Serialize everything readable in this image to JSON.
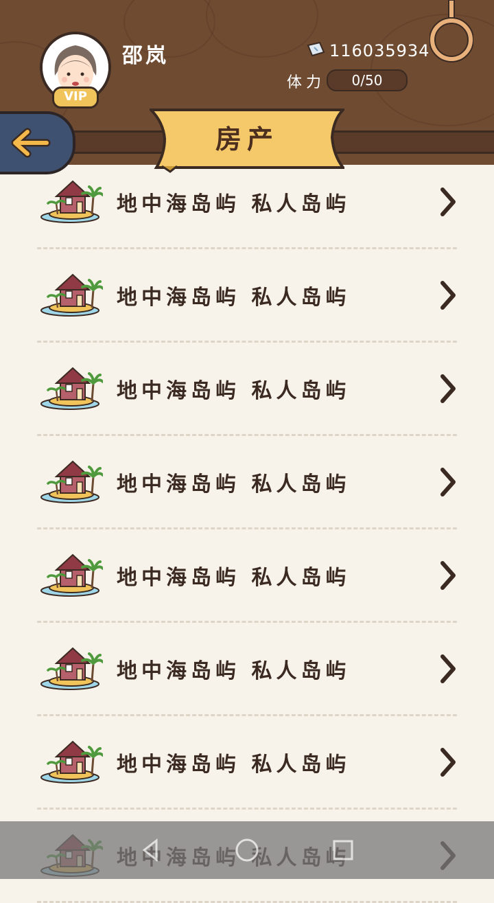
{
  "header": {
    "username": "邵岚",
    "vip_label": "VIP",
    "money": "116035934",
    "energy_label": "体力",
    "energy_value": "0/50"
  },
  "title": "房产",
  "list": {
    "items": [
      {
        "label": "地中海岛屿 私人岛屿"
      },
      {
        "label": "地中海岛屿 私人岛屿"
      },
      {
        "label": "地中海岛屿 私人岛屿"
      },
      {
        "label": "地中海岛屿 私人岛屿"
      },
      {
        "label": "地中海岛屿 私人岛屿"
      },
      {
        "label": "地中海岛屿 私人岛屿"
      },
      {
        "label": "地中海岛屿 私人岛屿"
      },
      {
        "label": "地中海岛屿 私人岛屿"
      }
    ]
  },
  "icons": {
    "back": "arrow-left-icon",
    "money": "ticket-icon",
    "ring": "ring-icon",
    "house": "island-house-icon",
    "chevron": "chevron-right-icon"
  },
  "colors": {
    "wood": "#6f4b32",
    "ribbon": "#f5c86a",
    "back_button": "#3e5170",
    "list_bg": "#f7f3ea"
  }
}
